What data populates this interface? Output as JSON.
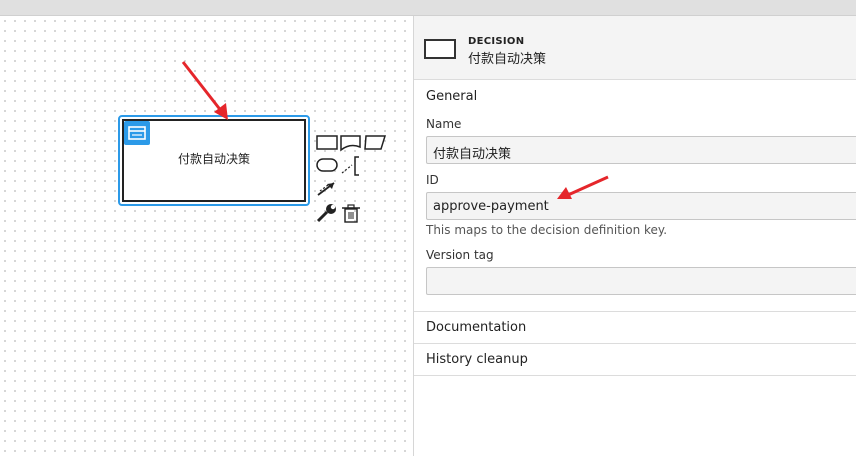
{
  "canvas": {
    "decision_label": "付款自动决策"
  },
  "panel": {
    "header": {
      "type": "DECISION",
      "name": "付款自动决策"
    },
    "general": {
      "title": "General",
      "name_label": "Name",
      "name_value": "付款自动决策",
      "id_label": "ID",
      "id_value": "approve-payment",
      "id_hint": "This maps to the decision definition key.",
      "version_label": "Version tag",
      "version_value": ""
    },
    "sections": {
      "documentation": "Documentation",
      "history": "History cleanup"
    }
  },
  "colors": {
    "selection": "#2c9ae8",
    "annotation_arrow": "#e5262b"
  }
}
